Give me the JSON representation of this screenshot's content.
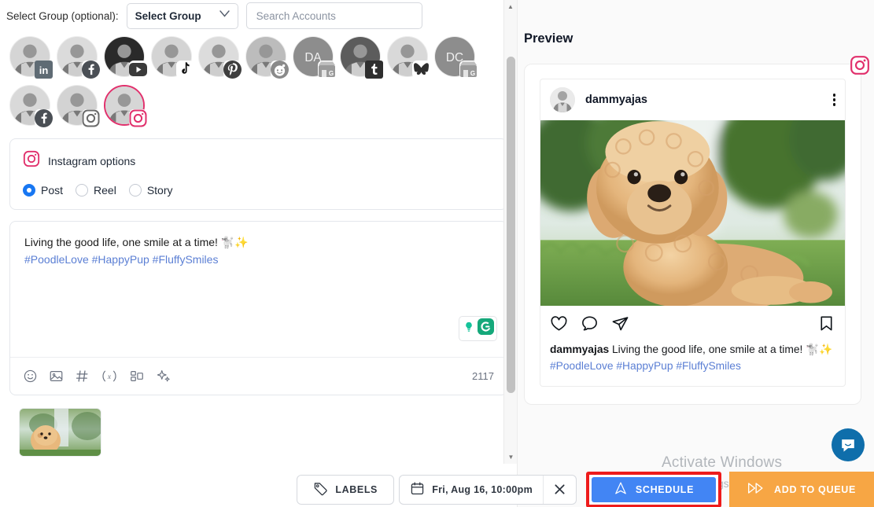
{
  "left": {
    "group_label": "Select Group (optional):",
    "select_group_value": "Select Group",
    "search_placeholder": "Search Accounts",
    "accounts": [
      {
        "name": "linkedin-account",
        "network": "linkedin",
        "selected": false,
        "initials": ""
      },
      {
        "name": "facebook-page-account",
        "network": "facebook",
        "selected": false,
        "initials": ""
      },
      {
        "name": "youtube-account",
        "network": "youtube",
        "selected": false,
        "initials": ""
      },
      {
        "name": "tiktok-account",
        "network": "tiktok",
        "selected": false,
        "initials": ""
      },
      {
        "name": "pinterest-account",
        "network": "pinterest",
        "selected": false,
        "initials": ""
      },
      {
        "name": "reddit-account",
        "network": "reddit",
        "selected": false,
        "initials": ""
      },
      {
        "name": "google-business-da-account",
        "network": "google-business",
        "selected": false,
        "initials": "DA"
      },
      {
        "name": "tumblr-account",
        "network": "tumblr",
        "selected": false,
        "initials": ""
      },
      {
        "name": "bluesky-account",
        "network": "bluesky",
        "selected": false,
        "initials": ""
      },
      {
        "name": "google-business-dc-account",
        "network": "google-business",
        "selected": false,
        "initials": "DC"
      },
      {
        "name": "facebook-second-account",
        "network": "facebook",
        "selected": false,
        "initials": ""
      },
      {
        "name": "instagram-account-1",
        "network": "instagram",
        "selected": false,
        "initials": ""
      },
      {
        "name": "instagram-account-2",
        "network": "instagram",
        "selected": true,
        "initials": ""
      }
    ],
    "instagram_options": {
      "title": "Instagram options",
      "post_types": [
        {
          "label": "Post",
          "selected": true
        },
        {
          "label": "Reel",
          "selected": false
        },
        {
          "label": "Story",
          "selected": false
        }
      ]
    },
    "composer": {
      "text": "Living the good life, one smile at a time! 🐩✨",
      "hashtags": "#PoodleLove #HappyPup #FluffySmiles",
      "char_count": "2117",
      "toolbar_icons": [
        "emoji-icon",
        "image-icon",
        "hashtag-icon",
        "variable-icon",
        "template-icon",
        "ai-sparkle-icon"
      ],
      "grammarly": "grammarly-widget"
    }
  },
  "right": {
    "preview_title": "Preview",
    "network_badge": "instagram-icon",
    "post": {
      "username": "dammyajas",
      "caption_author": "dammyajas",
      "caption_text": " Living the good life, one smile at a time! 🐩✨",
      "hashtags": "#PoodleLove #HappyPup #FluffySmiles",
      "actions": [
        "like-icon",
        "comment-icon",
        "share-icon",
        "save-icon"
      ]
    }
  },
  "watermark": {
    "line1": "Activate Windows",
    "line2": "Go to Settings to activate Windows."
  },
  "bottombar": {
    "labels_label": "LABELS",
    "date_label": "Fri, Aug 16, 10:00pm",
    "clear_date": "✕",
    "schedule_label": "SCHEDULE",
    "queue_label": "ADD TO QUEUE"
  },
  "colors": {
    "instagram": "#e1306c",
    "schedule_blue": "#4285f4",
    "queue_orange": "#f7a644",
    "highlight_red": "#ee1b1b",
    "hashtag_blue": "#5b7fd4",
    "intercom_blue": "#0f6eab"
  }
}
